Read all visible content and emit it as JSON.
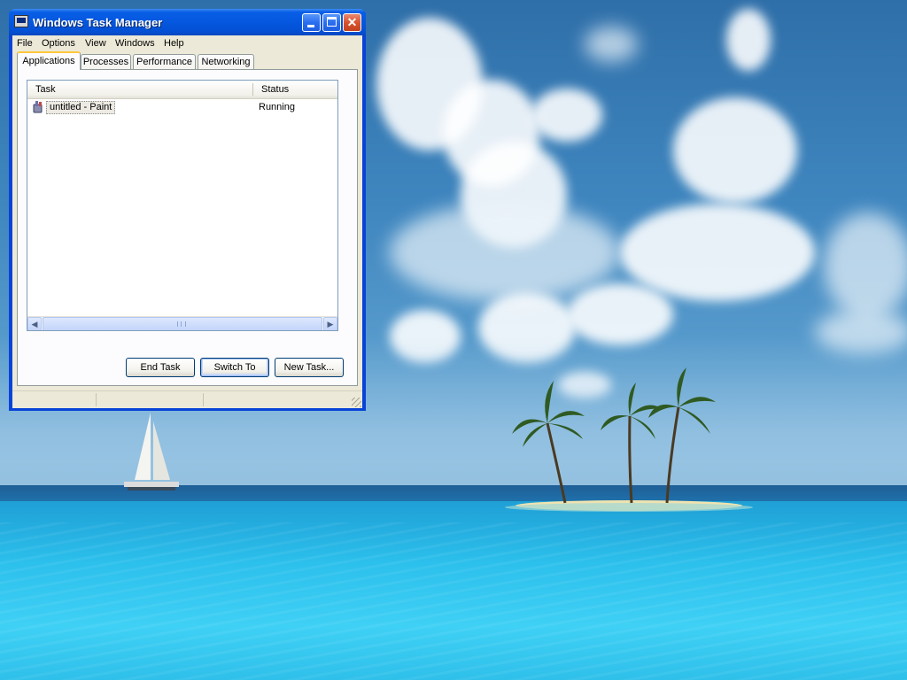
{
  "window": {
    "title": "Windows Task Manager",
    "controls": [
      "minimize",
      "maximize",
      "close"
    ]
  },
  "menu": {
    "items": [
      "File",
      "Options",
      "View",
      "Windows",
      "Help"
    ]
  },
  "tabs": [
    {
      "label": "Applications",
      "active": true
    },
    {
      "label": "Processes",
      "active": false
    },
    {
      "label": "Performance",
      "active": false
    },
    {
      "label": "Networking",
      "active": false
    }
  ],
  "task_list": {
    "columns": [
      "Task",
      "Status"
    ],
    "rows": [
      {
        "task": "untitled - Paint",
        "status": "Running",
        "icon": "paint-app-icon"
      }
    ]
  },
  "buttons": {
    "end_task": "End Task",
    "switch_to": "Switch To",
    "new_task": "New Task..."
  },
  "scrollbar": {
    "grip": "III"
  },
  "colors": {
    "title_bar": "#0558e0",
    "window_border": "#0843d8",
    "dialog_face": "#ece9d8",
    "active_tab_accent": "#ffc83c",
    "close_button": "#d8532e"
  }
}
